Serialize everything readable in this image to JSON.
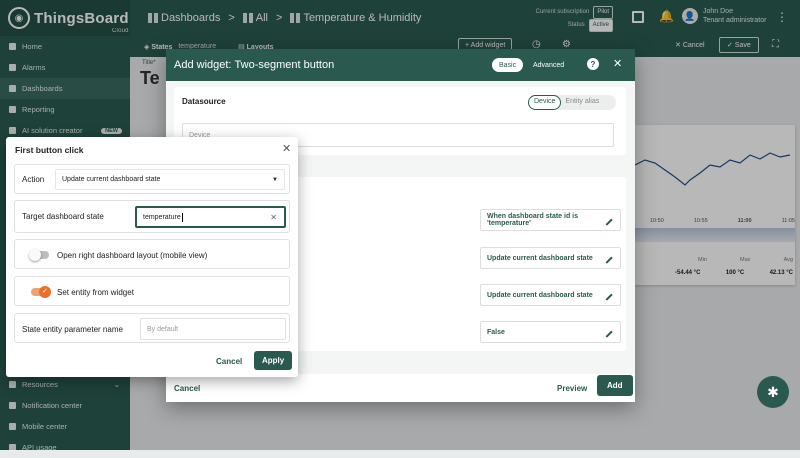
{
  "app": {
    "logo": "ThingsBoard",
    "logo_sub": "Cloud"
  },
  "breadcrumb": {
    "a": "Dashboards",
    "b": "All",
    "c": "Temperature & Humidity"
  },
  "subscription": {
    "label": "Current subscription",
    "plan": "Pilot",
    "status_label": "Status",
    "status": "Active"
  },
  "user": {
    "name": "John Doe",
    "role": "Tenant administrator"
  },
  "sidebar": {
    "items": [
      {
        "label": "Home"
      },
      {
        "label": "Alarms"
      },
      {
        "label": "Dashboards"
      },
      {
        "label": "Reporting"
      },
      {
        "label": "AI solution creator",
        "badge": "NEW"
      }
    ],
    "bottom": [
      {
        "label": "Resources"
      },
      {
        "label": "Notification center"
      },
      {
        "label": "Mobile center"
      },
      {
        "label": "API usage"
      }
    ]
  },
  "toolbar": {
    "states": "States",
    "state_value": "temperature",
    "layouts": "Layouts",
    "add_widget": "+ Add widget",
    "cancel": "Cancel",
    "save": "Save"
  },
  "dashboard": {
    "title_label": "Title*",
    "title": "Te"
  },
  "chart": {
    "x_ticks": [
      "10:50",
      "10:55",
      "11:00",
      "11:05"
    ],
    "min_label": "Min",
    "max_label": "Max",
    "avg_label": "Avg",
    "min": "-54.44 °C",
    "max": "100 °C",
    "avg": "42.13 °C"
  },
  "dialog": {
    "prefix": "Add widget:",
    "title": "Two-segment button",
    "basic": "Basic",
    "advanced": "Advanced",
    "datasource_label": "Datasource",
    "device": "Device",
    "entity_alias": "Entity alias",
    "device_placeholder": "Device",
    "rows": [
      "When dashboard state id is 'temperature'",
      "Update current dashboard state",
      "Update current dashboard state",
      "False"
    ],
    "cancel": "Cancel",
    "preview": "Preview",
    "add": "Add"
  },
  "popup": {
    "title": "First button click",
    "action_label": "Action",
    "action_value": "Update current dashboard state",
    "target_label": "Target dashboard state",
    "target_value": "temperature",
    "open_right_label": "Open right dashboard layout (mobile view)",
    "set_entity_label": "Set entity from widget",
    "state_param_label": "State entity parameter name",
    "state_param_placeholder": "By default",
    "cancel": "Cancel",
    "apply": "Apply"
  },
  "colors": {
    "primary": "#2a5a4f",
    "toggle_on": "#e8702a"
  }
}
